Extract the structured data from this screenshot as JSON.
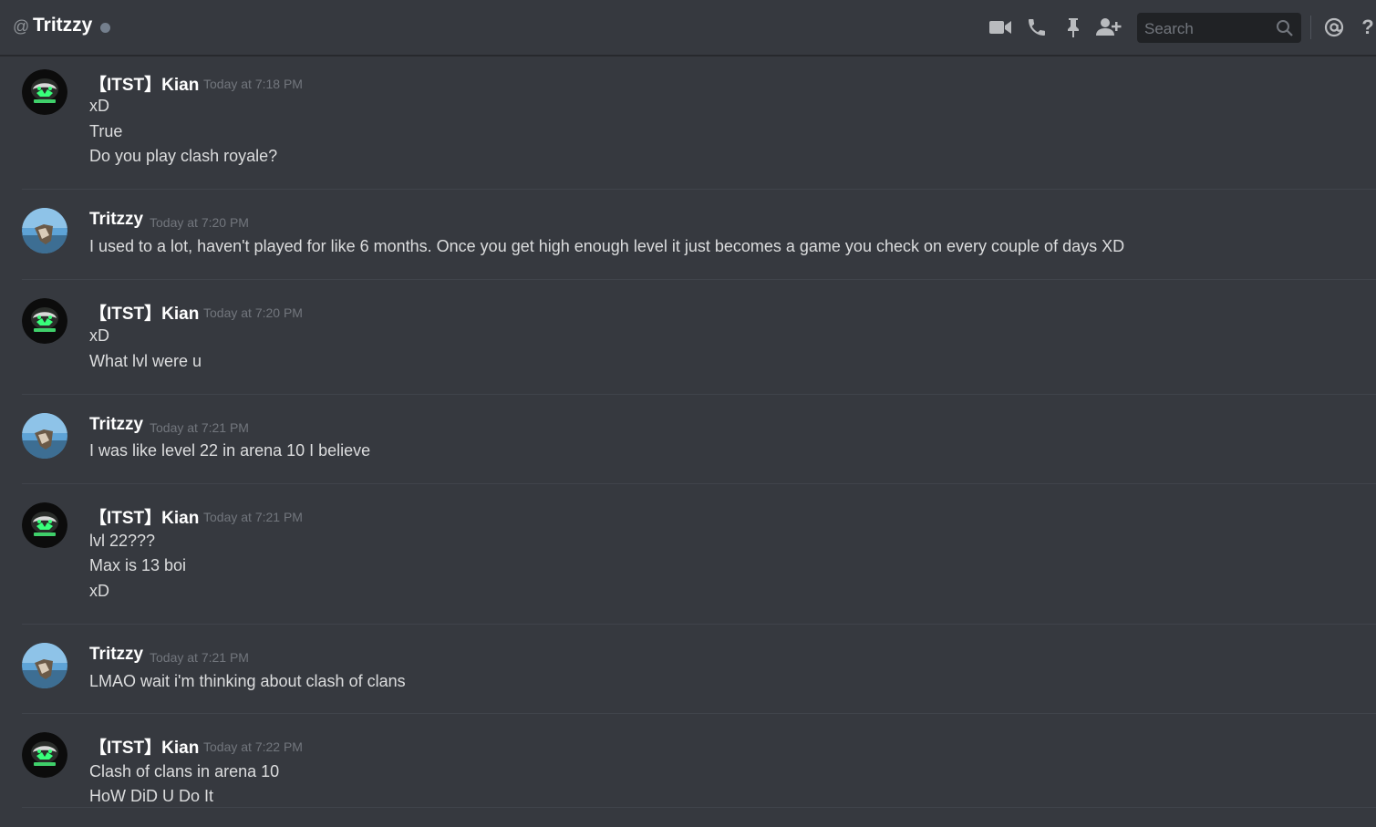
{
  "header": {
    "at_symbol": "@",
    "channel_name": "Tritzzy",
    "status": "offline",
    "search_placeholder": "Search",
    "icons": [
      "video-icon",
      "phone-icon",
      "pin-icon",
      "add-user-icon",
      "search-icon",
      "mention-icon",
      "help-icon"
    ],
    "help_glyph": "?"
  },
  "colors": {
    "background": "#36393f",
    "text": "#dcddde",
    "username": "#ffffff",
    "timestamp": "#72767d",
    "status_offline": "#747f8d"
  },
  "messages": [
    {
      "author": "【ITST】Kian",
      "timestamp": "Today at 7:18 PM",
      "lines": [
        "xD",
        "True",
        "Do you play clash royale?"
      ]
    },
    {
      "author": "Tritzzy",
      "timestamp": "Today at 7:20 PM",
      "lines": [
        "I used to a lot, haven't played for like 6 months. Once you get high enough level it just becomes a game you check on every couple of days XD"
      ]
    },
    {
      "author": "【ITST】Kian",
      "timestamp": "Today at 7:20 PM",
      "lines": [
        "xD",
        "What lvl were u"
      ]
    },
    {
      "author": "Tritzzy",
      "timestamp": "Today at 7:21 PM",
      "lines": [
        "I was like level 22 in arena 10 I believe"
      ]
    },
    {
      "author": "【ITST】Kian",
      "timestamp": "Today at 7:21 PM",
      "lines": [
        "lvl 22???",
        "Max is 13 boi",
        "xD"
      ]
    },
    {
      "author": "Tritzzy",
      "timestamp": "Today at 7:21 PM",
      "lines": [
        "LMAO wait i'm thinking about clash of clans"
      ]
    },
    {
      "author": "【ITST】Kian",
      "timestamp": "Today at 7:22 PM",
      "lines": [
        "Clash of clans in arena 10",
        "HoW DiD U Do It"
      ]
    }
  ]
}
